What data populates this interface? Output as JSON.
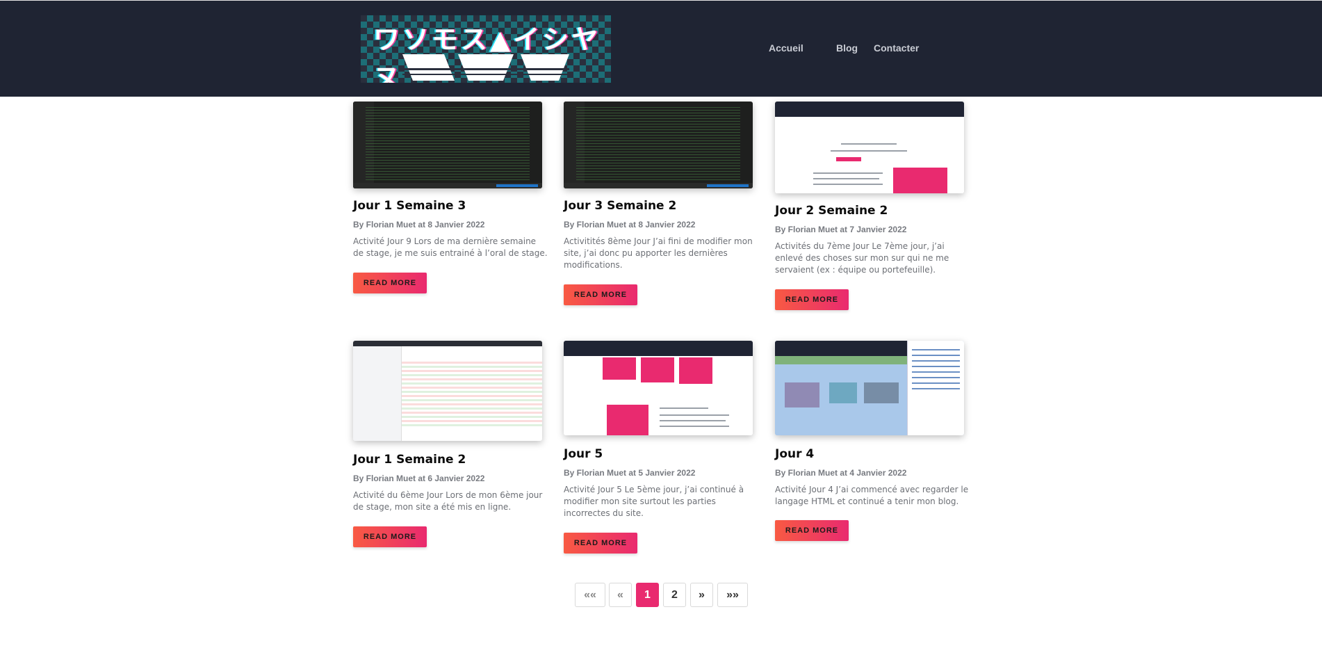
{
  "header": {
    "logo_text": "ワソモス▲イシヤヌ",
    "nav": [
      "Accueil",
      "Blog",
      "Contacter"
    ]
  },
  "posts": [
    {
      "title": "Jour 1 Semaine 3",
      "meta": "By Florian Muet  at 8 Janvier 2022",
      "excerpt": "Activité Jour 9 Lors de ma dernière semaine de stage, je me suis entrainé à l’oral de stage.",
      "button": "READ MORE"
    },
    {
      "title": "Jour 3 Semaine 2",
      "meta": "By Florian Muet  at 8 Janvier 2022",
      "excerpt": "Activitités 8ème Jour J’ai fini de modifier mon site, j’ai donc pu apporter les dernières modifications.",
      "button": "READ MORE"
    },
    {
      "title": "Jour 2 Semaine 2",
      "meta": "By Florian Muet  at 7 Janvier 2022",
      "excerpt": "Activités du 7ème Jour Le 7ème jour, j’ai enlevé des choses sur mon sur qui ne me servaient (ex : équipe ou portefeuille).",
      "button": "READ MORE"
    },
    {
      "title": "Jour 1 Semaine 2",
      "meta": "By Florian Muet  at 6 Janvier 2022",
      "excerpt": "Activité du 6ème Jour Lors de mon 6ème jour de stage, mon site a été mis en ligne.",
      "button": "READ MORE"
    },
    {
      "title": "Jour 5",
      "meta": "By Florian Muet  at 5 Janvier 2022",
      "excerpt": "Activité Jour 5 Le 5ème jour, j’ai continué à modifier mon site surtout les parties incorrectes du site.",
      "button": "READ MORE"
    },
    {
      "title": "Jour 4",
      "meta": "By Florian Muet  at 4 Janvier 2022",
      "excerpt": "Activité Jour 4 J’ai commencé avec regarder le langage HTML et continué a tenir mon blog.",
      "button": "READ MORE"
    }
  ],
  "pagination": {
    "first": "««",
    "prev": "«",
    "pages": [
      "1",
      "2"
    ],
    "current": "1",
    "next": "»",
    "last": "»»"
  },
  "colors": {
    "header_bg": "#1f2433",
    "accent": "#e92a6f",
    "button_gradient_start": "#f85a43"
  }
}
